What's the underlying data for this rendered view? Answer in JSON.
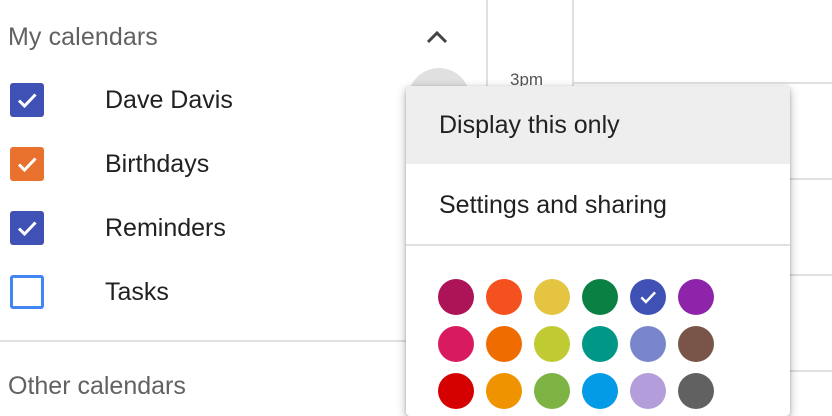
{
  "sidebar": {
    "my_calendars_title": "My calendars",
    "other_calendars_title": "Other calendars",
    "calendars": [
      {
        "label": "Dave Davis",
        "checked": true,
        "color": "#3f51b5"
      },
      {
        "label": "Birthdays",
        "checked": true,
        "color": "#e8722d"
      },
      {
        "label": "Reminders",
        "checked": true,
        "color": "#3f51b5"
      },
      {
        "label": "Tasks",
        "checked": false,
        "color": "#4285f4"
      }
    ]
  },
  "grid": {
    "time_label": "3pm"
  },
  "menu": {
    "display_only_label": "Display this only",
    "settings_label": "Settings and sharing",
    "colors": [
      {
        "name": "Radicchio",
        "hex": "#ad1457",
        "selected": false
      },
      {
        "name": "Tangerine",
        "hex": "#f4511e",
        "selected": false
      },
      {
        "name": "Citron",
        "hex": "#e4c441",
        "selected": false
      },
      {
        "name": "Basil",
        "hex": "#0b8043",
        "selected": false
      },
      {
        "name": "Blueberry",
        "hex": "#3f51b5",
        "selected": true
      },
      {
        "name": "Grape",
        "hex": "#8e24aa",
        "selected": false
      },
      {
        "name": "Cherry Blossom",
        "hex": "#d81b60",
        "selected": false
      },
      {
        "name": "Pumpkin",
        "hex": "#ef6c00",
        "selected": false
      },
      {
        "name": "Avocado",
        "hex": "#c0ca33",
        "selected": false
      },
      {
        "name": "Eucalyptus",
        "hex": "#009688",
        "selected": false
      },
      {
        "name": "Lavender",
        "hex": "#7986cb",
        "selected": false
      },
      {
        "name": "Cocoa",
        "hex": "#795548",
        "selected": false
      },
      {
        "name": "Tomato",
        "hex": "#d50000",
        "selected": false
      },
      {
        "name": "Mango",
        "hex": "#f09300",
        "selected": false
      },
      {
        "name": "Pistachio",
        "hex": "#7cb342",
        "selected": false
      },
      {
        "name": "Peacock",
        "hex": "#039be5",
        "selected": false
      },
      {
        "name": "Wisteria",
        "hex": "#b39ddb",
        "selected": false
      },
      {
        "name": "Graphite",
        "hex": "#616161",
        "selected": false
      }
    ]
  }
}
